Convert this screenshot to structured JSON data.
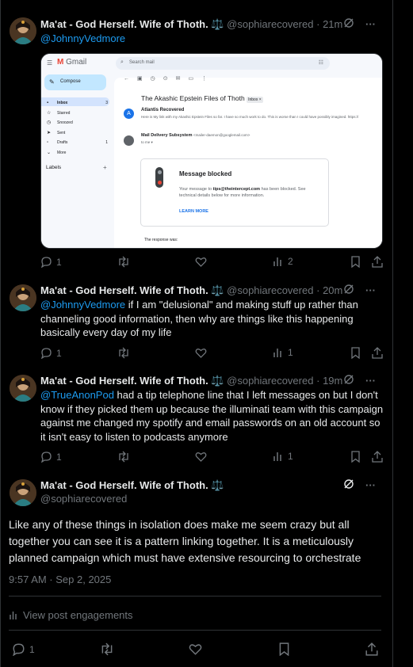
{
  "posts": [
    {
      "name": "Ma'at - God Herself. Wife of Thoth.",
      "badge": "⚖️",
      "handle": "@sophiarecovered",
      "time": "21m",
      "mention": "@JohnnyVedmore",
      "text": "",
      "replies": "1",
      "reposts": "",
      "likes": "",
      "views": "2"
    },
    {
      "name": "Ma'at - God Herself. Wife of Thoth.",
      "badge": "⚖️",
      "handle": "@sophiarecovered",
      "time": "20m",
      "mention": "@JohnnyVedmore",
      "text": " if I am \"delusional\" and making stuff up rather than channeling good information, then why are things like this happening basically every day of my life",
      "replies": "1",
      "reposts": "",
      "likes": "",
      "views": "1"
    },
    {
      "name": "Ma'at - God Herself. Wife of Thoth.",
      "badge": "⚖️",
      "handle": "@sophiarecovered",
      "time": "19m",
      "mention": "@TrueAnonPod",
      "text": " had a tip telephone line that I left messages on but I don't know if they picked them up because the illuminati team with this campaign against me changed my spotify and email passwords on an old account so it isn't easy to listen to podcasts anymore",
      "replies": "1",
      "reposts": "",
      "likes": "",
      "views": "1"
    }
  ],
  "main_post": {
    "name": "Ma'at - God Herself. Wife of Thoth.",
    "badge": "⚖️",
    "handle": "@sophiarecovered",
    "text": "Like any of these things in isolation does make me seem crazy but all together you can see it is a pattern linking together. It is a meticulously planned campaign which must have extensive resourcing to orchestrate",
    "timestamp": "9:57 AM · Sep 2, 2025",
    "engagements": "View post engagements",
    "replies": "1"
  },
  "gmail": {
    "logo": "Gmail",
    "search": "Search mail",
    "compose": "Compose",
    "nav": [
      {
        "label": "Inbox",
        "count": "3"
      },
      {
        "label": "Starred",
        "count": ""
      },
      {
        "label": "Snoozed",
        "count": ""
      },
      {
        "label": "Sent",
        "count": ""
      },
      {
        "label": "Drafts",
        "count": "1"
      },
      {
        "label": "More",
        "count": ""
      }
    ],
    "labels_heading": "Labels",
    "subject": "The Akashic Epstein Files of Thoth",
    "inbox_tag": "Inbox ×",
    "sender1": "Atlantis Recovered",
    "sender1_initial": "A",
    "sender1_preview": "Here is My link with my Akashic Epstein Files so far. I have so much work to do. This is worse than I could have possibly imagined. https://",
    "sender2": "Mail Delivery Subsystem",
    "sender2_email": "<mailer-daemon@googlemail.com>",
    "sender2_to": "to me ▾",
    "blocked_title": "Message blocked",
    "blocked_prefix": "Your message to ",
    "blocked_email": "tips@theintercept.com",
    "blocked_suffix": " has been blocked. See technical details below for more information.",
    "learn_more": "LEARN MORE",
    "response": "The response was:"
  }
}
